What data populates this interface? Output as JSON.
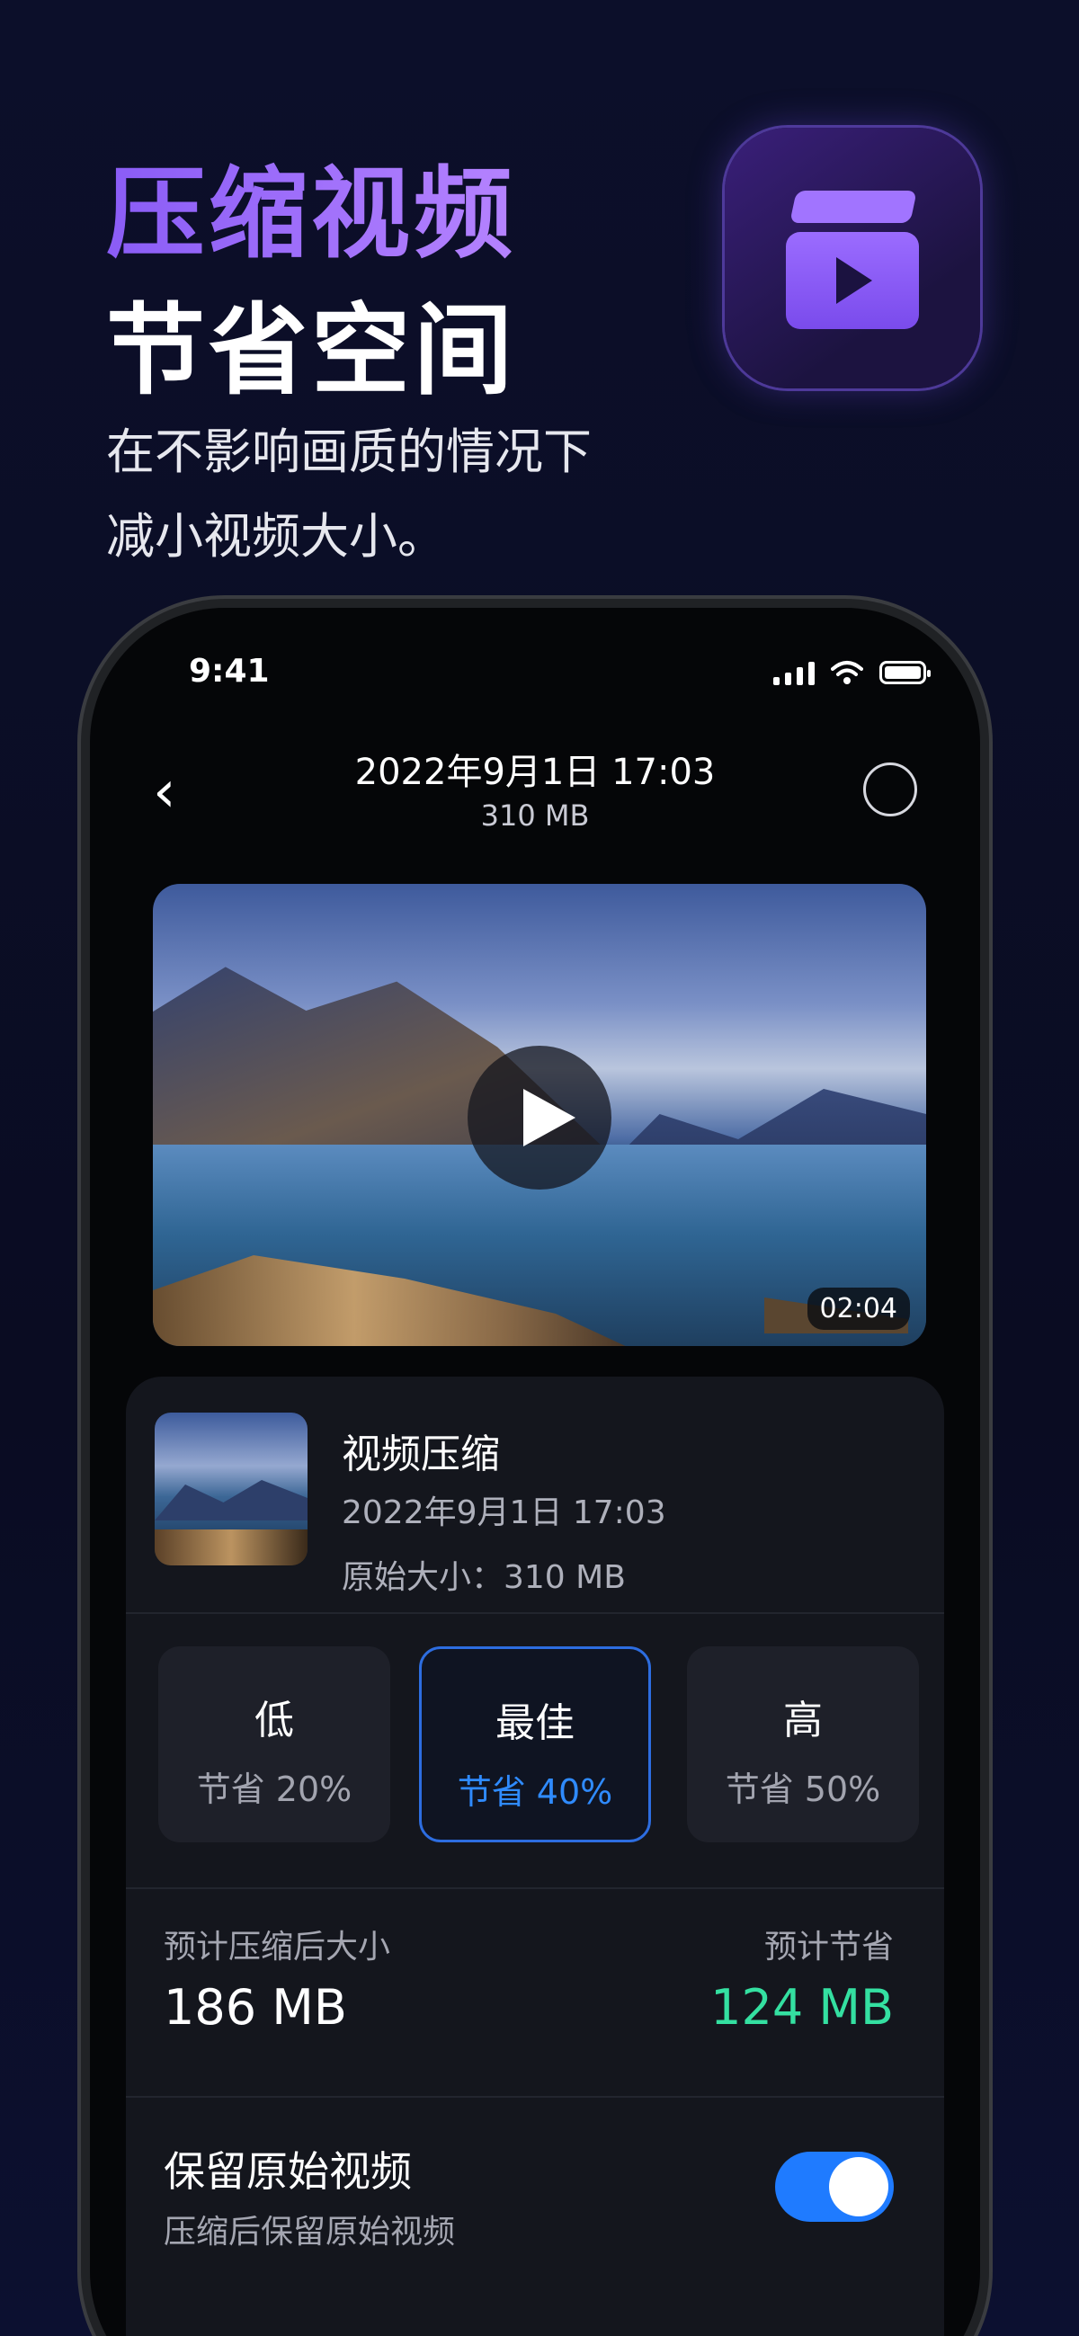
{
  "hero": {
    "title_line1": "压缩视频",
    "title_line2": "节省空间",
    "subtitle_line1": "在不影响画质的情况下",
    "subtitle_line2": "减小视频大小。"
  },
  "status_bar": {
    "time": "9:41"
  },
  "nav": {
    "title": "2022年9月1日 17:03",
    "subtitle": "310 MB"
  },
  "video": {
    "duration": "02:04"
  },
  "info": {
    "title": "视频压缩",
    "date": "2022年9月1日 17:03",
    "original_size": "原始大小：310 MB"
  },
  "options": [
    {
      "label": "低",
      "saving": "节省 20%",
      "selected": false
    },
    {
      "label": "最佳",
      "saving": "节省 40%",
      "selected": true
    },
    {
      "label": "高",
      "saving": "节省 50%",
      "selected": false
    }
  ],
  "estimate": {
    "size_label": "预计压缩后大小",
    "size_value": "186 MB",
    "saving_label": "预计节省",
    "saving_value": "124 MB"
  },
  "keep_original": {
    "title": "保留原始视频",
    "subtitle": "压缩后保留原始视频",
    "enabled": true
  },
  "colors": {
    "accent_purple": "#8a5cf6",
    "accent_blue": "#2f8bff",
    "saving_green": "#34e0a1",
    "background": "#0b0d24"
  }
}
